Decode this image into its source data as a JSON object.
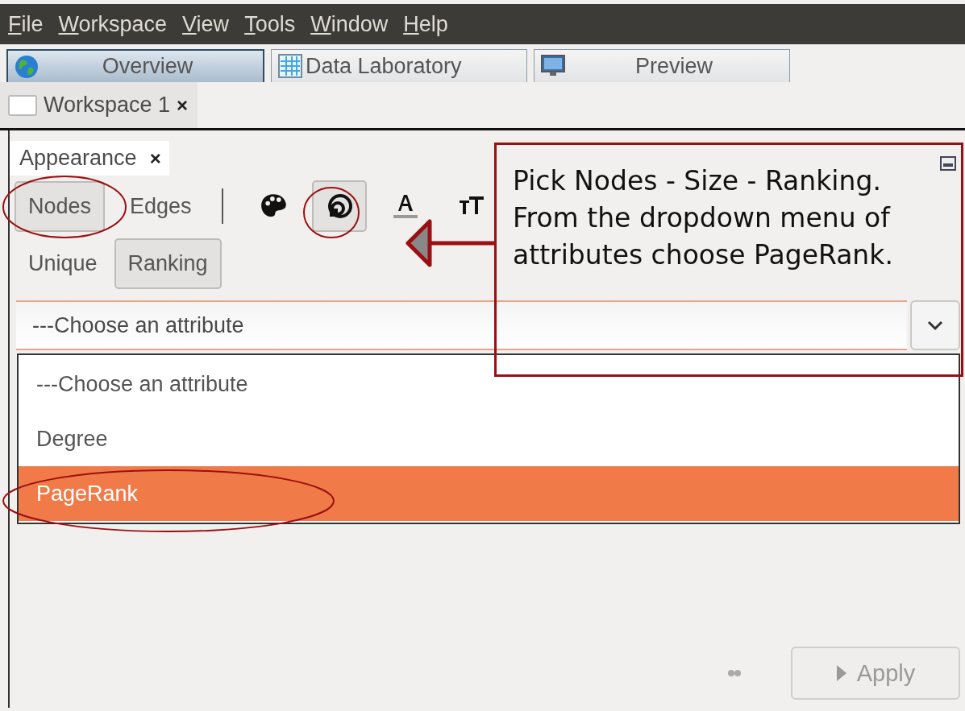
{
  "menu": [
    "File",
    "Workspace",
    "View",
    "Tools",
    "Window",
    "Help"
  ],
  "perspectives": [
    {
      "label": "Overview",
      "selected": true
    },
    {
      "label": "Data Laboratory",
      "selected": false
    },
    {
      "label": "Preview",
      "selected": false
    }
  ],
  "workspace_tab": {
    "label": "Workspace 1",
    "close": "×"
  },
  "panel": {
    "title": "Appearance",
    "close": "×",
    "element_tabs": [
      {
        "label": "Nodes",
        "selected": true
      },
      {
        "label": "Edges",
        "selected": false
      }
    ],
    "property_tools": [
      {
        "kind": "color",
        "selected": false
      },
      {
        "kind": "size",
        "selected": true
      },
      {
        "kind": "label_color",
        "selected": false
      },
      {
        "kind": "label_size",
        "selected": false
      }
    ],
    "mode_tabs": [
      {
        "label": "Unique",
        "selected": false
      },
      {
        "label": "Ranking",
        "selected": true
      }
    ],
    "attribute_dropdown": {
      "value": "---Choose an attribute",
      "options": [
        {
          "label": "---Choose an attribute",
          "highlighted": false
        },
        {
          "label": "Degree",
          "highlighted": false
        },
        {
          "label": "PageRank",
          "highlighted": true
        }
      ]
    },
    "apply_button": {
      "label": "Apply",
      "disabled": true
    }
  },
  "annotation": {
    "text": "Pick Nodes - Size - Ranking. From the dropdown menu of attributes choose PageRank."
  }
}
